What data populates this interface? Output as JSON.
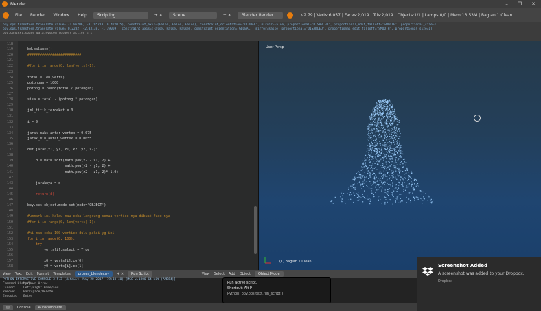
{
  "window": {
    "title": "Blender",
    "controls": [
      "–",
      "❐",
      "✕"
    ]
  },
  "info_header": {
    "menus": [
      "File",
      "Render",
      "Window",
      "Help"
    ],
    "screen_layout": "Scripting",
    "scene": "Scene",
    "render_engine": "Blender Render",
    "stats": "v2.79 | Verts:6,057 | Faces:2,019 | Tris:2,019 | Objects:1/1 | Lamps:0/0 | Mem:13.53M | Bagian 1 Clean"
  },
  "log_lines": [
    "bpy.ops.transform.translate(value=(-1.96206, -0.795718, 0.427075), constraint_axis=(False, False, False), constraint_orientation='GLOBAL', mirror=False, proportional='DISABLED', proportional_edit_falloff='SMOOTH', proportional_size=1)",
    "bpy.ops.transform.translate(value=(0.2282, -2.03138, -1.39059), constraint_axis=(False, False, False), constraint_orientation='GLOBAL', mirror=False, proportional='DISABLED', proportional_edit_falloff='SMOOTH', proportional_size=1)",
    "bpy.context.space_data.system_folders_active = 1"
  ],
  "code_lines": [
    {
      "n": "118",
      "t": "",
      "c": "def"
    },
    {
      "n": "119",
      "t": "bd.balance()",
      "c": "def"
    },
    {
      "n": "120",
      "t": "##########################",
      "c": "comment"
    },
    {
      "n": "121",
      "t": "",
      "c": "def"
    },
    {
      "n": "122",
      "t": "#for i in range(0, len(verts)-1):",
      "c": "comment"
    },
    {
      "n": "123",
      "t": "",
      "c": "def"
    },
    {
      "n": "124",
      "t": "total = len(verts)",
      "c": "def"
    },
    {
      "n": "125",
      "t": "potongan = 1000",
      "c": "def"
    },
    {
      "n": "126",
      "t": "potong = round(total / potongan)",
      "c": "def"
    },
    {
      "n": "127",
      "t": "",
      "c": "def"
    },
    {
      "n": "128",
      "t": "sisa = total - (potong * potongan)",
      "c": "def"
    },
    {
      "n": "129",
      "t": "",
      "c": "def"
    },
    {
      "n": "130",
      "t": "jml_titik_terdekat = 0",
      "c": "def"
    },
    {
      "n": "131",
      "t": "",
      "c": "def"
    },
    {
      "n": "132",
      "t": "i = 0",
      "c": "def"
    },
    {
      "n": "133",
      "t": "",
      "c": "def"
    },
    {
      "n": "134",
      "t": "jarak_maks_antar_vertex = 0.075",
      "c": "def"
    },
    {
      "n": "135",
      "t": "jarak_min_antar_vertex = 0.0055",
      "c": "def"
    },
    {
      "n": "136",
      "t": "",
      "c": "def"
    },
    {
      "n": "137",
      "t": "def jarak(x1, y1, z1, x2, y2, z2):",
      "c": "def"
    },
    {
      "n": "138",
      "t": "",
      "c": "def"
    },
    {
      "n": "139",
      "t": "    d = math.sqrt(math.pow(x2 - x1, 2) +",
      "c": "def"
    },
    {
      "n": "140",
      "t": "                  math.pow(y2 - y1, 2) +",
      "c": "def"
    },
    {
      "n": "141",
      "t": "                  math.pow(z2 - z1, 2)* 1.0)",
      "c": "def"
    },
    {
      "n": "142",
      "t": "",
      "c": "def"
    },
    {
      "n": "143",
      "t": "    jaraknya = d",
      "c": "def"
    },
    {
      "n": "144",
      "t": "",
      "c": "def"
    },
    {
      "n": "145",
      "t": "    return(d)",
      "c": "red"
    },
    {
      "n": "146",
      "t": "",
      "c": "def"
    },
    {
      "n": "147",
      "t": "bpy.ops.object.mode_set(mode='OBJECT')",
      "c": "def"
    },
    {
      "n": "148",
      "t": "",
      "c": "def"
    },
    {
      "n": "149",
      "t": "#ummark ini kalau mau coba langsung semua vertice nya dibuat face nya",
      "c": "comment"
    },
    {
      "n": "150",
      "t": "#for i in range(0, len(verts)-1):",
      "c": "comment"
    },
    {
      "n": "151",
      "t": "",
      "c": "def"
    },
    {
      "n": "152",
      "t": "#ki mau coba 100 vertice dulu pakai yg ini",
      "c": "comment"
    },
    {
      "n": "153",
      "t": "for i in range(0, 100):",
      "c": "kw"
    },
    {
      "n": "154",
      "t": "    try:",
      "c": "kw"
    },
    {
      "n": "155",
      "t": "        verts[i].select = True",
      "c": "def"
    },
    {
      "n": "156",
      "t": "",
      "c": "def"
    },
    {
      "n": "157",
      "t": "        x0 = verts[i].co[0]",
      "c": "def"
    },
    {
      "n": "158",
      "t": "        y0 = verts[i].co[1]",
      "c": "def"
    },
    {
      "n": "159",
      "t": "        z0 = verts[i].co[2]",
      "c": "def"
    }
  ],
  "viewport": {
    "view_label": "User Persp",
    "object_label": "(1) Bagian 1 Clean"
  },
  "text_header": {
    "items": [
      "View",
      "Text",
      "Edit",
      "Format",
      "Templates"
    ],
    "filename": "proses_blender.py",
    "run_script": "Run Script",
    "mode_label": "Object Mode",
    "view3d_items": [
      "View",
      "Select",
      "Add",
      "Object"
    ]
  },
  "console": {
    "header_line": "PYTHON INTERACTIVE CONSOLE 3.5.3 (default, May 20 2017, 19:10:40) [MSC v.1800 64 bit (AMD64)]",
    "rows": [
      {
        "k": "Command History:",
        "v": "Up/Down Arrow"
      },
      {
        "k": "Cursor:",
        "v": "Left/Right Home/End"
      },
      {
        "k": "Remove:",
        "v": "Backspace/Delete"
      },
      {
        "k": "Execute:",
        "v": "Enter"
      }
    ],
    "footer_items": [
      "Console",
      "Autocomplete"
    ]
  },
  "tooltip": {
    "title": "Run active script.",
    "shortcut": "Shortcut: Alt P",
    "python": "Python: bpy.ops.text.run_script()"
  },
  "notification": {
    "title": "Screenshot Added",
    "message": "A screenshot was added to your Dropbox.",
    "source": "Dropbox"
  }
}
